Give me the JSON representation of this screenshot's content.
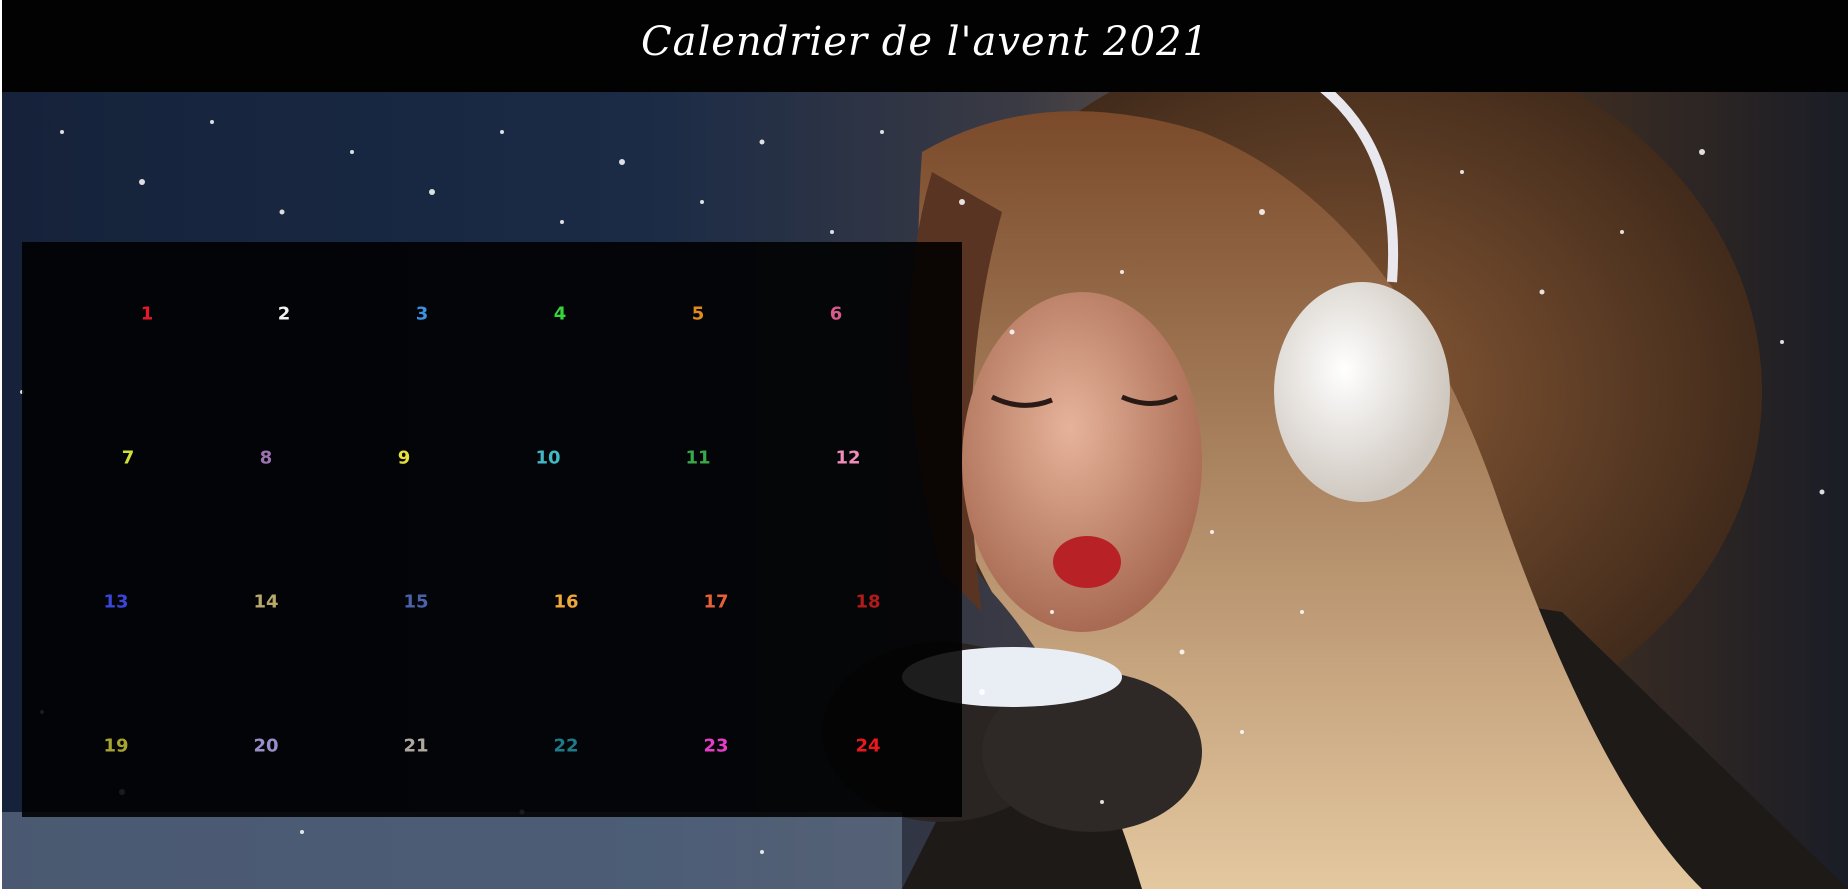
{
  "header": {
    "title": "Calendrier de l'avent 2021"
  },
  "calendar": {
    "days": [
      {
        "label": "1",
        "color": "#e8182c"
      },
      {
        "label": "2",
        "color": "#f2f2f2"
      },
      {
        "label": "3",
        "color": "#3f8fe0"
      },
      {
        "label": "4",
        "color": "#38d43b"
      },
      {
        "label": "5",
        "color": "#e08a1e"
      },
      {
        "label": "6",
        "color": "#d85a8c"
      },
      {
        "label": "7",
        "color": "#cfe03a"
      },
      {
        "label": "8",
        "color": "#9b73b0"
      },
      {
        "label": "9",
        "color": "#e6e03a"
      },
      {
        "label": "10",
        "color": "#42b8c4"
      },
      {
        "label": "11",
        "color": "#3aa84a"
      },
      {
        "label": "12",
        "color": "#f08cba"
      },
      {
        "label": "13",
        "color": "#3a46d8"
      },
      {
        "label": "14",
        "color": "#b8a96a"
      },
      {
        "label": "15",
        "color": "#4a62a8"
      },
      {
        "label": "16",
        "color": "#f0a838"
      },
      {
        "label": "17",
        "color": "#e8603a"
      },
      {
        "label": "18",
        "color": "#b01a1a"
      },
      {
        "label": "19",
        "color": "#a8a230"
      },
      {
        "label": "20",
        "color": "#9a8ec8"
      },
      {
        "label": "21",
        "color": "#b0a8a0"
      },
      {
        "label": "22",
        "color": "#1e7a8a"
      },
      {
        "label": "23",
        "color": "#e83cc8"
      },
      {
        "label": "24",
        "color": "#e8181c"
      }
    ]
  }
}
